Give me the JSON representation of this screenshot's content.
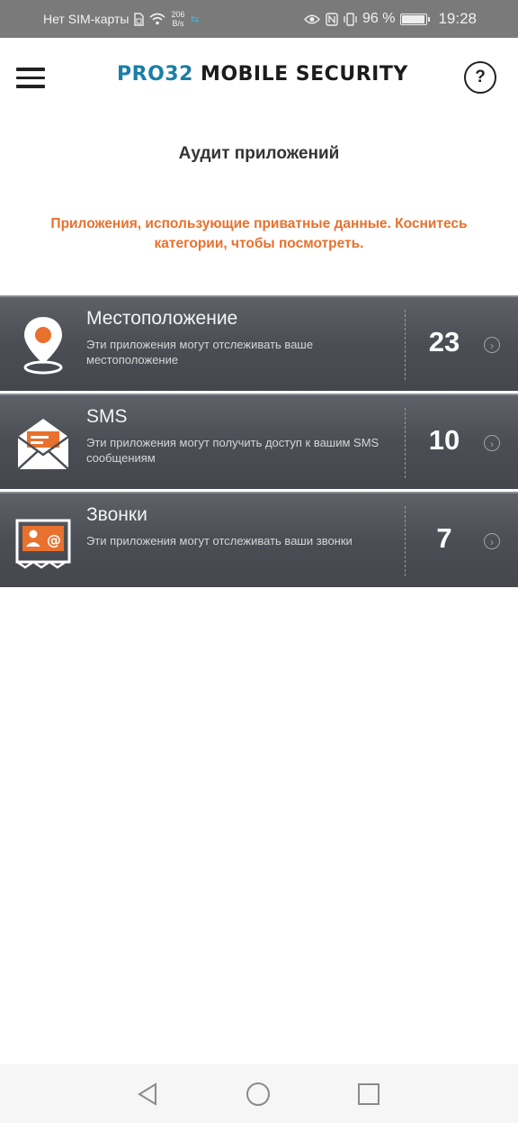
{
  "status_bar": {
    "carrier": "Нет SIM-карты",
    "speed_value": "206",
    "speed_unit": "B/s",
    "battery_percent": "96 %",
    "time": "19:28"
  },
  "header": {
    "logo_part1": "PRO32",
    "logo_part2": " MOBILE SECURITY",
    "help_label": "?"
  },
  "page": {
    "title": "Аудит приложений",
    "subtitle": "Приложения, использующие приватные данные. Коснитесь категории, чтобы посмотреть."
  },
  "categories": [
    {
      "title": "Местоположение",
      "description": "Эти приложения могут отслеживать ваше местоположение",
      "count": "23",
      "icon": "location-pin-icon"
    },
    {
      "title": "SMS",
      "description": "Эти приложения могут получить доступ к вашим SMS сообщениям",
      "count": "10",
      "icon": "envelope-icon"
    },
    {
      "title": "Звонки",
      "description": "Эти приложения могут отслеживать ваши звонки",
      "count": "7",
      "icon": "contact-card-icon"
    }
  ],
  "colors": {
    "accent_orange": "#e8712d",
    "logo_blue": "#1a7fa6"
  },
  "navigation": {
    "back": "back-icon",
    "home": "home-icon",
    "recents": "recents-icon"
  }
}
